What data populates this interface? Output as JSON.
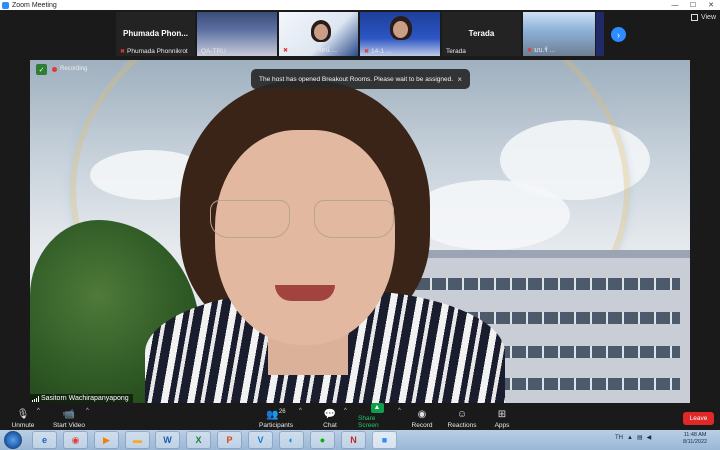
{
  "window": {
    "title": "Zoom Meeting"
  },
  "thumbnails": [
    {
      "big_name": "Phumada   Phon...",
      "small_name": "Phumada Phonnikrot",
      "muted": true
    },
    {
      "big_name": "",
      "small_name": "QA-TRU",
      "muted": false
    },
    {
      "big_name": "",
      "small_name": "ผศ.ดร.ศุภรัตน์ ...",
      "muted": true
    },
    {
      "big_name": "",
      "small_name": "14-1 ...",
      "muted": true
    },
    {
      "big_name": "Terada",
      "small_name": "Terada",
      "muted": false
    },
    {
      "big_name": "",
      "small_name": "มบ.ร์ ...",
      "muted": true
    }
  ],
  "view_button": {
    "label": "View"
  },
  "main_video": {
    "speaker_name": "Sasitorn Wachirapanyapong",
    "recording_label": "Recording"
  },
  "notification": {
    "message": "The host has opened Breakout Rooms. Please wait to be assigned.",
    "close": "×"
  },
  "toolbar": {
    "unmute": "Unmute",
    "start_video": "Start Video",
    "participants": "Participants",
    "participants_count": "26",
    "chat": "Chat",
    "share_screen": "Share Screen",
    "record": "Record",
    "reactions": "Reactions",
    "apps": "Apps",
    "leave": "Leave"
  },
  "taskbar": {
    "language": "TH",
    "time": "11:48 AM",
    "date": "8/11/2022"
  }
}
